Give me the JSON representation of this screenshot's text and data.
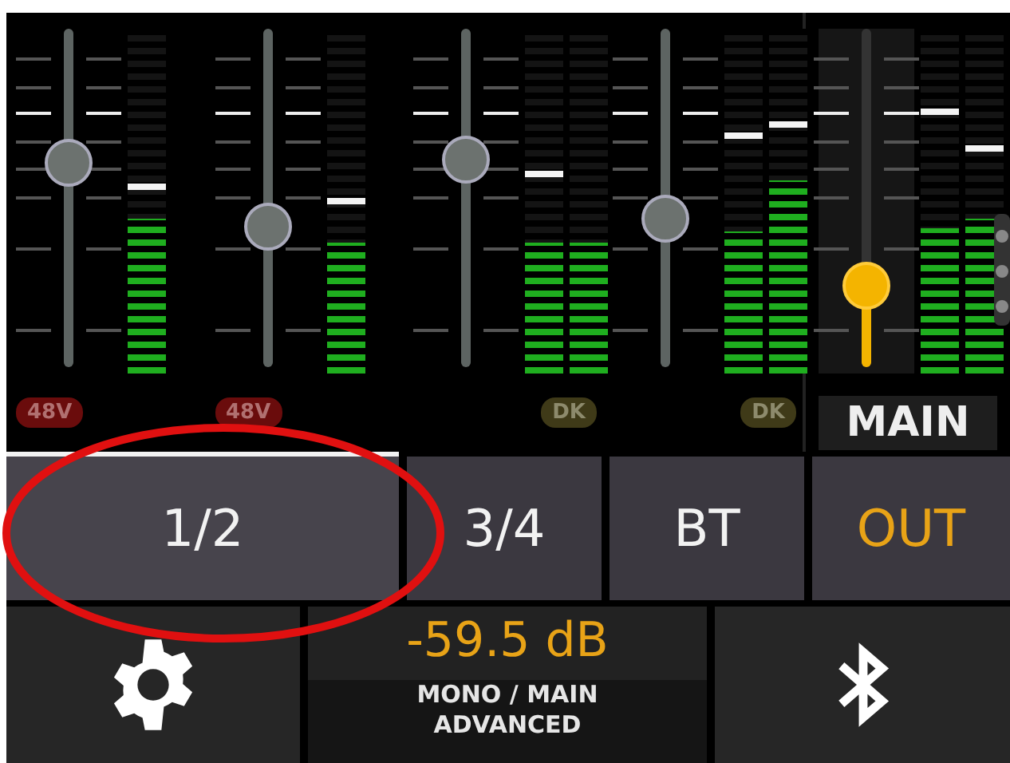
{
  "channels": [
    {
      "badge": {
        "label": "48V",
        "kind": "phantom"
      },
      "fader": {
        "level": 0.62
      },
      "meters": [
        {
          "level": 0.45,
          "peak": {
            "level": 0.55
          }
        }
      ]
    },
    {
      "badge": {
        "label": "48V",
        "kind": "phantom"
      },
      "fader": {
        "level": 0.4
      },
      "meters": [
        {
          "level": 0.38,
          "peak": {
            "level": 0.51
          }
        }
      ]
    },
    {
      "badge": {
        "label": "DK",
        "kind": "duck"
      },
      "fader": {
        "level": 0.63
      },
      "meters": [
        {
          "level": 0.38,
          "peak": {
            "level": 0.59
          }
        },
        {
          "level": 0.38
        }
      ]
    },
    {
      "badge": {
        "label": "DK",
        "kind": "duck"
      },
      "fader": {
        "level": 0.43
      },
      "meters": [
        {
          "level": 0.41,
          "peak": {
            "level": 0.7
          }
        },
        {
          "level": 0.56,
          "peak": {
            "level": 0.73
          }
        }
      ]
    }
  ],
  "main": {
    "label": "MAIN",
    "fader": {
      "level": 0.2
    },
    "meters": [
      {
        "level": 0.42,
        "peak": {
          "level": 0.77
        }
      },
      {
        "level": 0.45,
        "peak": {
          "level": 0.66
        }
      }
    ]
  },
  "tabs": [
    {
      "label": "1/2",
      "selected": true,
      "accent": false
    },
    {
      "label": "3/4",
      "selected": false,
      "accent": false
    },
    {
      "label": "BT",
      "selected": false,
      "accent": false
    },
    {
      "label": "OUT",
      "selected": false,
      "accent": true
    }
  ],
  "readout": {
    "value": "-59.5 dB",
    "lines": [
      "MONO / MAIN",
      "ADVANCED"
    ]
  }
}
